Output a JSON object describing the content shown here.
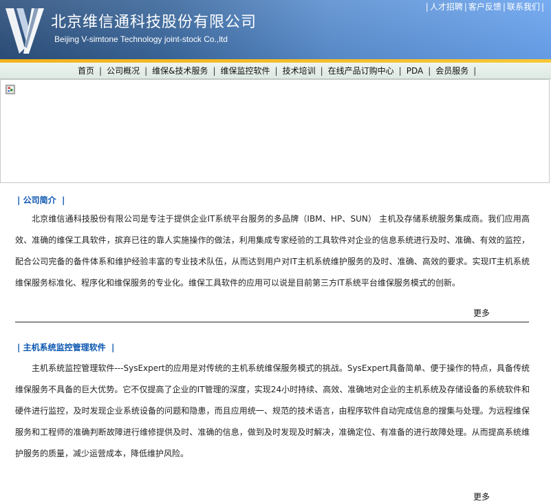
{
  "header": {
    "company_cn": "北京维信通科技股份有限公司",
    "company_en": "Beijing V-simtone Technology joint-stock Co.,ltd",
    "top_links": [
      "人才招聘",
      "客户反馈",
      "联系我们"
    ],
    "brand_color": "#3a679c",
    "accent_color": "#f1b21c"
  },
  "nav": {
    "items": [
      "首页",
      "公司概况",
      "维保&技术服务",
      "维保监控软件",
      "技术培训",
      "在线产品订购中心",
      "PDA",
      "会员服务"
    ]
  },
  "banner": {
    "icon": "broken-image-icon"
  },
  "sections": [
    {
      "title": "公司简介",
      "body": "北京维信通科技股份有限公司是专注于提供企业IT系统平台服务的多品牌（IBM、HP、SUN） 主机及存储系统服务集成商。我们应用高效、准确的维保工具软件，摈弃已往的靠人实施操作的做法，利用集成专家经验的工具软件对企业的信息系统进行及时、准确、有效的监控，配合公司完备的备件体系和维护经验丰富的专业技术队伍，从而达到用户对IT主机系统维护服务的及时、准确、高效的要求。实现IT主机系统维保服务标准化、程序化和维保服务的专业化。维保工具软件的应用可以说是目前第三方IT系统平台维保服务模式的创新。",
      "more": "更多"
    },
    {
      "title": "主机系统监控管理软件",
      "body": "主机系统监控管理软件---SysExpert的应用是对传统的主机系统维保服务模式的挑战。SysExpert具备简单、便于操作的特点，具备传统维保服务不具备的巨大优势。它不仅提高了企业的IT管理的深度，实现24小时持续、高效、准确地对企业的主机系统及存储设备的系统软件和硬件进行监控，及时发现企业系统设备的问题和隐患，而且应用统一、规范的技术语言，由程序软件自动完成信息的搜集与处理。为远程维保服务和工程师的准确判断故障进行维修提供及时、准确的信息，做到及时发现及时解决，准确定位、有准备的进行故障处理。从而提高系统维护服务的质量，减少运营成本，降低维护风险。",
      "more": "更多"
    }
  ]
}
